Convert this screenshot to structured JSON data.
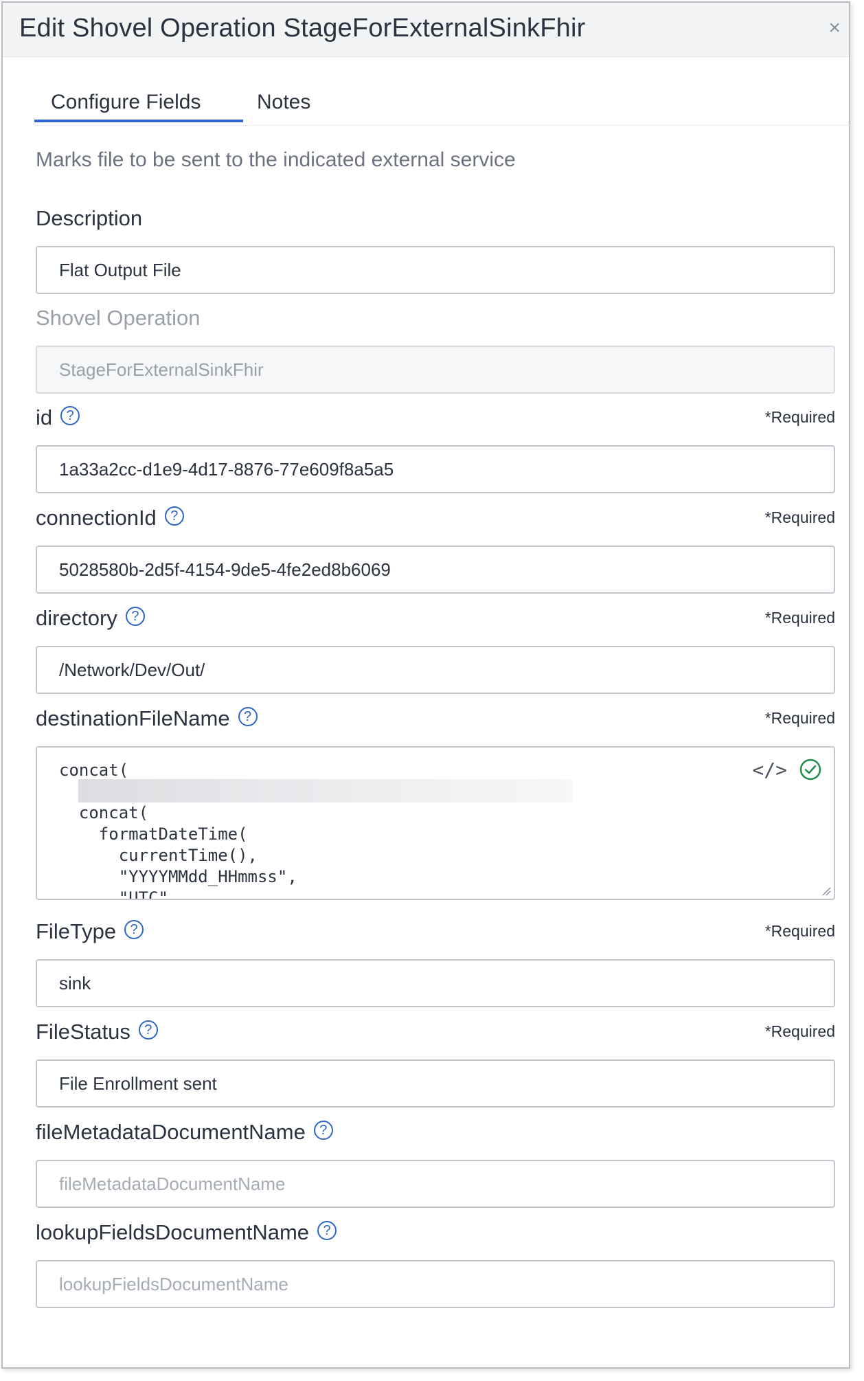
{
  "modal": {
    "title": "Edit Shovel Operation StageForExternalSinkFhir",
    "close_icon": "×"
  },
  "tabs": [
    {
      "label": "Configure Fields",
      "active": true
    },
    {
      "label": "Notes",
      "active": false
    }
  ],
  "description_text": "Marks file to be sent to the indicated external service",
  "required_text": "*Required",
  "help_icon": "?",
  "fields": {
    "description": {
      "label": "Description",
      "value": "Flat Output File"
    },
    "shovel_operation": {
      "label": "Shovel Operation",
      "value": "StageForExternalSinkFhir",
      "disabled": true
    },
    "id": {
      "label": "id",
      "value": "1a33a2cc-d1e9-4d17-8876-77e609f8a5a5"
    },
    "connection_id": {
      "label": "connectionId",
      "value": "5028580b-2d5f-4154-9de5-4fe2ed8b6069"
    },
    "directory": {
      "label": "directory",
      "value": "/Network/Dev/Out/"
    },
    "destination_file_name": {
      "label": "destinationFileName",
      "code": "concat(\n\n  concat(\n    formatDateTime(\n      currentTime(),\n      \"YYYYMMdd_HHmmss\",\n      \"UTC\""
    },
    "file_type": {
      "label": "FileType",
      "value": "sink"
    },
    "file_status": {
      "label": "FileStatus",
      "value": "File Enrollment sent"
    },
    "file_metadata_document_name": {
      "label": "fileMetadataDocumentName",
      "placeholder": "fileMetadataDocumentName"
    },
    "lookup_fields_document_name": {
      "label": "lookupFieldsDocumentName",
      "placeholder": "lookupFieldsDocumentName"
    }
  },
  "icons": {
    "code_icon": "</>",
    "check_icon": "check-circle-icon"
  },
  "colors": {
    "accent": "#2f66c9",
    "success": "#1f8a4c",
    "header_bg": "#f3f4f6"
  }
}
